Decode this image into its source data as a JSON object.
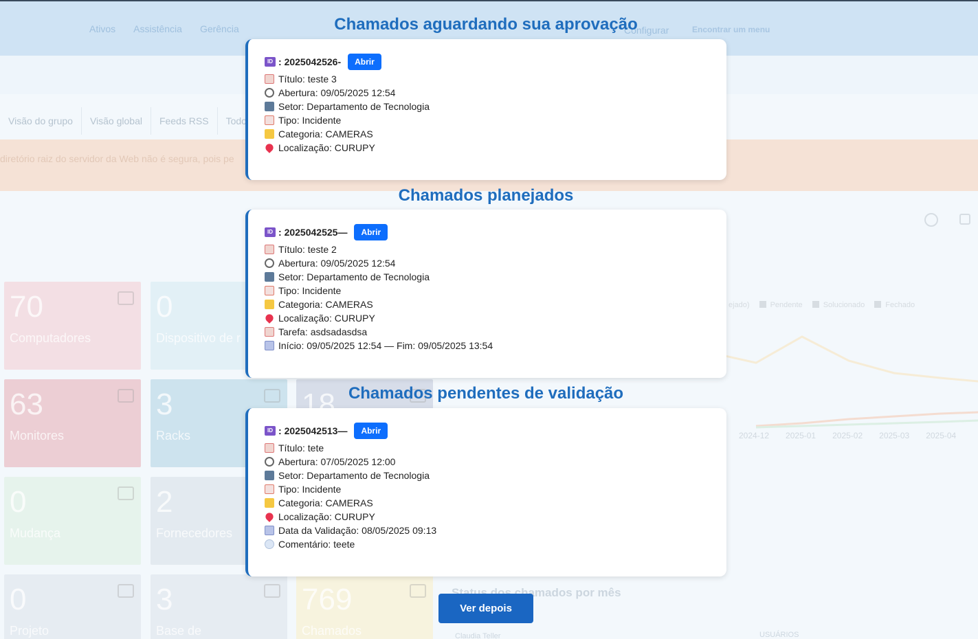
{
  "background": {
    "menu": [
      "Ativos",
      "Assistência",
      "Gerência",
      "Configurar"
    ],
    "find_menu": "Encontrar um menu",
    "tabs": [
      "Visão do grupo",
      "Visão global",
      "Feeds RSS",
      "Todo"
    ],
    "warning": "diretório raiz do servidor da Web não é segura, pois pe",
    "tiles": [
      {
        "num": "70",
        "label": "Computadores",
        "color": "#f3dfe4"
      },
      {
        "num": "0",
        "label": "Dispositivo de r",
        "color": "#e2f0f6"
      },
      {
        "num": "63",
        "label": "Monitores",
        "color": "#ecced4"
      },
      {
        "num": "3",
        "label": "Racks",
        "color": "#cde3ee"
      },
      {
        "num": "18",
        "label": "",
        "color": "#d7dde9"
      },
      {
        "num": "0",
        "label": "Mudança",
        "color": "#e6f3ec"
      },
      {
        "num": "2",
        "label": "Fornecedores",
        "color": "#e3eaf0"
      },
      {
        "num": "0",
        "label": "Projeto",
        "color": "#e6ecf2"
      },
      {
        "num": "3",
        "label": "Base de",
        "color": "#e6ecf2"
      },
      {
        "num": "769",
        "label": "Chamados",
        "color": "#f7f3de"
      }
    ],
    "legend": [
      "ejado)",
      "Pendente",
      "Solucionado",
      "Fechado"
    ],
    "x_labels": [
      "2024-12",
      "2025-01",
      "2025-02",
      "2025-03",
      "2025-04"
    ],
    "status_title": "Status dos chamados por mês",
    "bottom_left": "Claudia Teller",
    "bottom_right": "USUÁRIOS"
  },
  "sections": [
    {
      "title": "Chamados aguardando sua aprovação",
      "id": "2025042526",
      "id_sep": " -",
      "open_label": "Abrir",
      "rows": [
        {
          "icon": "title",
          "icon_name": "memo-icon",
          "text": "Título: teste 3"
        },
        {
          "icon": "clock",
          "icon_name": "clock-icon",
          "text": "Abertura: 09/05/2025 12:54"
        },
        {
          "icon": "building",
          "icon_name": "building-icon",
          "text": "Setor: Departamento de Tecnologia"
        },
        {
          "icon": "type",
          "icon_name": "clipboard-icon",
          "text": "Tipo: Incidente"
        },
        {
          "icon": "folder",
          "icon_name": "folder-icon",
          "text": "Categoria: CAMERAS"
        },
        {
          "icon": "pin",
          "icon_name": "pin-icon",
          "text": "Localização: CURUPY"
        }
      ]
    },
    {
      "title": "Chamados planejados",
      "id": "2025042525",
      "id_sep": " —",
      "open_label": "Abrir",
      "rows": [
        {
          "icon": "title",
          "icon_name": "memo-icon",
          "text": "Título: teste 2"
        },
        {
          "icon": "clock",
          "icon_name": "clock-icon",
          "text": "Abertura: 09/05/2025 12:54"
        },
        {
          "icon": "building",
          "icon_name": "building-icon",
          "text": "Setor: Departamento de Tecnologia"
        },
        {
          "icon": "type",
          "icon_name": "clipboard-icon",
          "text": "Tipo: Incidente"
        },
        {
          "icon": "folder",
          "icon_name": "folder-icon",
          "text": "Categoria: CAMERAS"
        },
        {
          "icon": "pin",
          "icon_name": "pin-icon",
          "text": "Localização: CURUPY"
        },
        {
          "icon": "title",
          "icon_name": "memo-icon",
          "text": "Tarefa: asdsadasdsa"
        },
        {
          "icon": "calendar",
          "icon_name": "calendar-icon",
          "text": "Início: 09/05/2025 12:54 — Fim: 09/05/2025 13:54"
        }
      ]
    },
    {
      "title": "Chamados pendentes de validação",
      "id": "2025042513",
      "id_sep": " —",
      "open_label": "Abrir",
      "rows": [
        {
          "icon": "title",
          "icon_name": "memo-icon",
          "text": "Título: tete"
        },
        {
          "icon": "clock",
          "icon_name": "clock-icon",
          "text": "Abertura: 07/05/2025 12:00"
        },
        {
          "icon": "building",
          "icon_name": "building-icon",
          "text": "Setor: Departamento de Tecnologia"
        },
        {
          "icon": "type",
          "icon_name": "clipboard-icon",
          "text": "Tipo: Incidente"
        },
        {
          "icon": "folder",
          "icon_name": "folder-icon",
          "text": "Categoria: CAMERAS"
        },
        {
          "icon": "pin",
          "icon_name": "pin-icon",
          "text": "Localização: CURUPY"
        },
        {
          "icon": "calendar",
          "icon_name": "calendar-icon",
          "text": "Data da Validação: 08/05/2025 09:13"
        },
        {
          "icon": "chat",
          "icon_name": "speech-bubble-icon",
          "text": "Comentário: teete"
        }
      ]
    }
  ],
  "later_button": "Ver depois",
  "colors": {
    "accent": "#1f6dbd",
    "open_button": "#0d6efd",
    "later_button": "#1a66c2"
  }
}
